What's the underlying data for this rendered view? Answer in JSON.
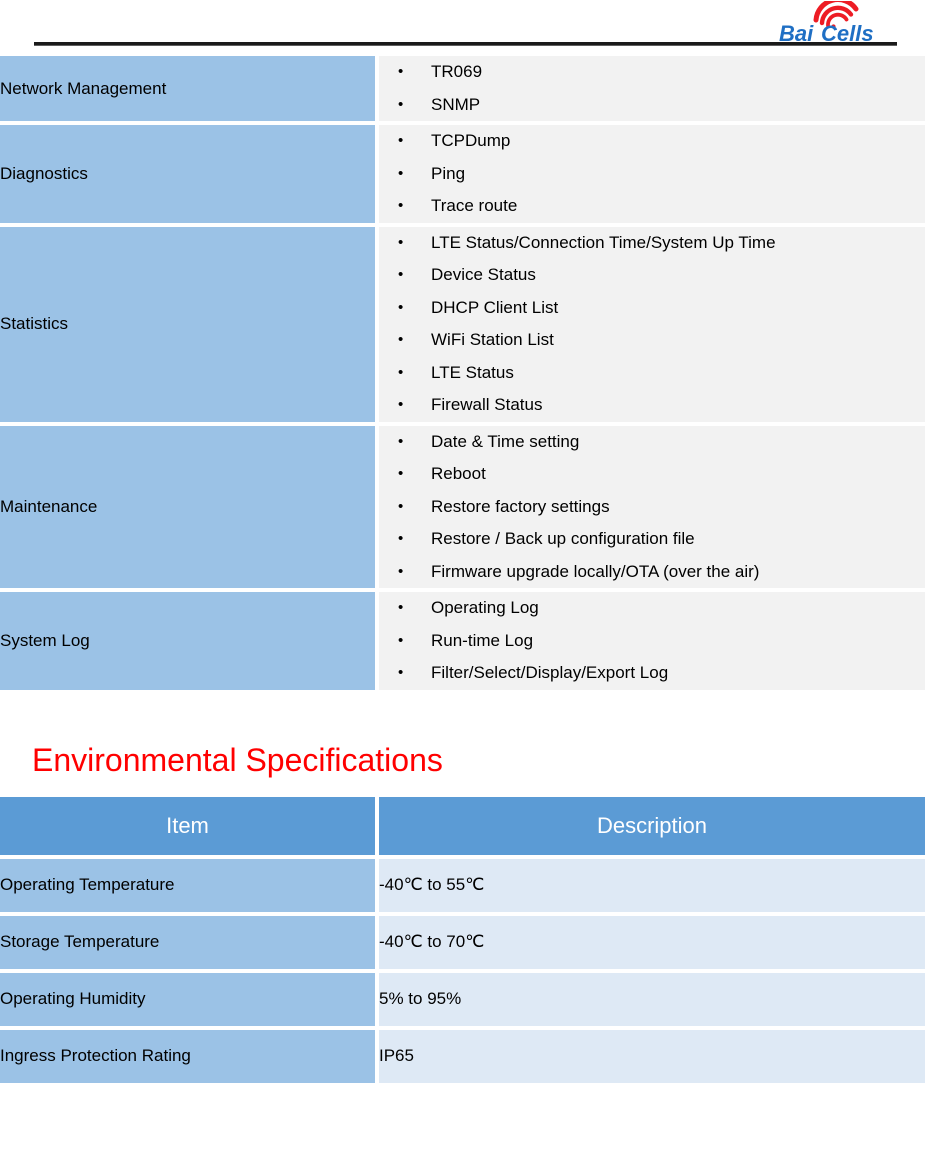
{
  "header": {
    "logo_name": "Bai Cells",
    "logo_text_primary": "Bai",
    "logo_text_secondary": "Cells",
    "logo_blue": "#1F6FC4",
    "logo_red": "#ED1C24"
  },
  "features_table": {
    "rows": [
      {
        "label": "Network Management",
        "items": [
          "TR069",
          "SNMP"
        ]
      },
      {
        "label": "Diagnostics",
        "items": [
          "TCPDump",
          "Ping",
          "Trace route"
        ]
      },
      {
        "label": "Statistics",
        "items": [
          "LTE Status/Connection Time/System Up Time",
          "Device Status",
          "DHCP Client List",
          "WiFi Station List",
          "LTE Status",
          "Firewall Status"
        ]
      },
      {
        "label": "Maintenance",
        "items": [
          "Date & Time setting",
          "Reboot",
          "Restore factory settings",
          "Restore / Back up configuration file",
          "Firmware upgrade locally/OTA (over the air)"
        ]
      },
      {
        "label": "System Log",
        "items": [
          "Operating Log",
          "Run-time Log",
          "Filter/Select/Display/Export Log"
        ]
      }
    ]
  },
  "environmental_section": {
    "heading": "Environmental Specifications",
    "heading_color": "#FF0000",
    "columns": [
      "Item",
      "Description"
    ],
    "rows": [
      {
        "item": "Operating Temperature",
        "description": "-40℃ to 55℃"
      },
      {
        "item": "Storage Temperature",
        "description": "-40℃ to 70℃"
      },
      {
        "item": "Operating Humidity",
        "description": "5% to 95%"
      },
      {
        "item": "Ingress Protection Rating",
        "description": "IP65"
      }
    ]
  },
  "colors": {
    "label_blue": "#9BC2E6",
    "body_gray": "#F2F2F2",
    "header_blue": "#5B9BD5",
    "desc_blue": "#DEE9F5"
  }
}
